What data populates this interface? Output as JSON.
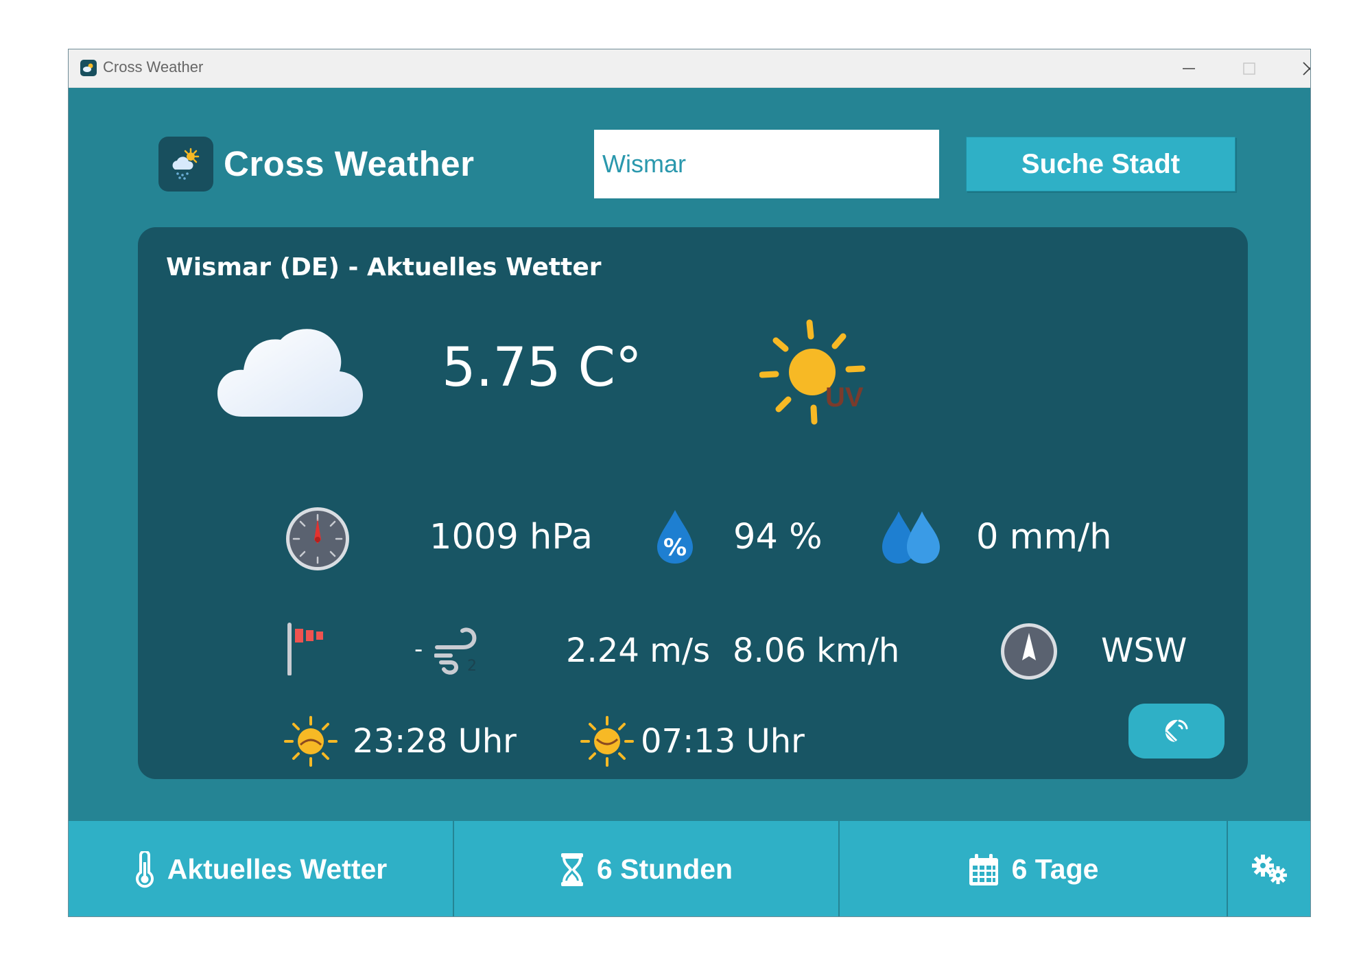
{
  "window": {
    "title": "Cross Weather"
  },
  "header": {
    "app_title": "Cross Weather",
    "search": {
      "value": "Wismar",
      "button_label": "Suche Stadt"
    }
  },
  "current": {
    "heading": "Wismar (DE) - Aktuelles Wetter",
    "temperature": "5.75 C°",
    "uv_label": "UV",
    "pressure": "1009 hPa",
    "humidity": "94 %",
    "humidity_icon_label": "%",
    "precipitation": "0 mm/h",
    "wind_level": "-",
    "wind_level_sub": "2",
    "wind_speed_ms": "2.24 m/s",
    "wind_speed_kmh": "8.06 km/h",
    "wind_direction": "WSW",
    "sunrise": "23:28 Uhr",
    "sunset": "07:13 Uhr"
  },
  "nav": {
    "current_weather": "Aktuelles Wetter",
    "six_hours": "6 Stunden",
    "six_days": "6 Tage"
  },
  "colors": {
    "window_bg": "#258494",
    "card_bg": "#185564",
    "accent": "#2fb0c6",
    "sun": "#f7b925"
  }
}
